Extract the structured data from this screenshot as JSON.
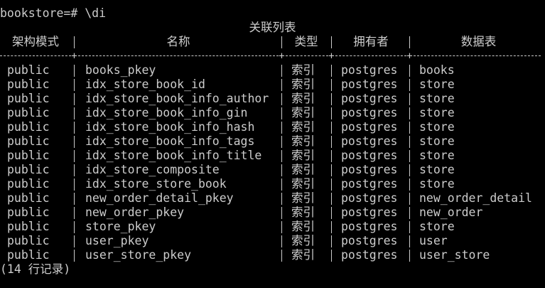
{
  "prompt": "bookstore=# \\di",
  "title": "关联列表",
  "headers": {
    "schema": "架构模式",
    "name": "名称",
    "type": "类型",
    "owner": "拥有者",
    "table": "数据表"
  },
  "separator_plus": "+",
  "rows": [
    {
      "schema": "public",
      "name": "books_pkey",
      "type": "索引",
      "owner": "postgres",
      "table": "books"
    },
    {
      "schema": "public",
      "name": "idx_store_book_id",
      "type": "索引",
      "owner": "postgres",
      "table": "store"
    },
    {
      "schema": "public",
      "name": "idx_store_book_info_author",
      "type": "索引",
      "owner": "postgres",
      "table": "store"
    },
    {
      "schema": "public",
      "name": "idx_store_book_info_gin",
      "type": "索引",
      "owner": "postgres",
      "table": "store"
    },
    {
      "schema": "public",
      "name": "idx_store_book_info_hash",
      "type": "索引",
      "owner": "postgres",
      "table": "store"
    },
    {
      "schema": "public",
      "name": "idx_store_book_info_tags",
      "type": "索引",
      "owner": "postgres",
      "table": "store"
    },
    {
      "schema": "public",
      "name": "idx_store_book_info_title",
      "type": "索引",
      "owner": "postgres",
      "table": "store"
    },
    {
      "schema": "public",
      "name": "idx_store_composite",
      "type": "索引",
      "owner": "postgres",
      "table": "store"
    },
    {
      "schema": "public",
      "name": "idx_store_store_book",
      "type": "索引",
      "owner": "postgres",
      "table": "store"
    },
    {
      "schema": "public",
      "name": "new_order_detail_pkey",
      "type": "索引",
      "owner": "postgres",
      "table": "new_order_detail"
    },
    {
      "schema": "public",
      "name": "new_order_pkey",
      "type": "索引",
      "owner": "postgres",
      "table": "new_order"
    },
    {
      "schema": "public",
      "name": "store_pkey",
      "type": "索引",
      "owner": "postgres",
      "table": "store"
    },
    {
      "schema": "public",
      "name": "user_pkey",
      "type": "索引",
      "owner": "postgres",
      "table": "user"
    },
    {
      "schema": "public",
      "name": "user_store_pkey",
      "type": "索引",
      "owner": "postgres",
      "table": "user_store"
    }
  ],
  "footer": "(14 行记录)",
  "colors": {
    "background": "#000000",
    "foreground": "#cccccc"
  }
}
